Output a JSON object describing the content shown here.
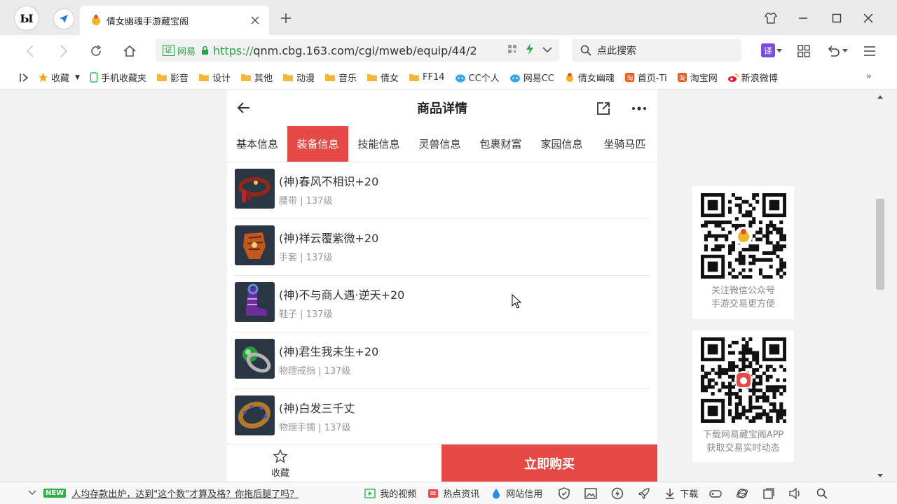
{
  "browser": {
    "logo_text": "Ы",
    "tab_title": "倩女幽魂手游藏宝阁",
    "url_scheme": "https://",
    "url_rest": "qnm.cbg.163.com/cgi/mweb/equip/44/2",
    "cert_label": "证",
    "cert_org": "网易",
    "search_placeholder": "点此搜索",
    "translate_label": "译"
  },
  "bookmarks": [
    {
      "label": "收藏",
      "icon": "star-icon"
    },
    {
      "label": "手机收藏夹",
      "icon": "phone-icon"
    },
    {
      "label": "影音",
      "icon": "folder-icon"
    },
    {
      "label": "设计",
      "icon": "folder-icon"
    },
    {
      "label": "其他",
      "icon": "folder-icon"
    },
    {
      "label": "动漫",
      "icon": "folder-icon"
    },
    {
      "label": "音乐",
      "icon": "folder-icon"
    },
    {
      "label": "倩女",
      "icon": "folder-icon"
    },
    {
      "label": "FF14",
      "icon": "folder-icon"
    },
    {
      "label": "CC个人",
      "icon": "cc-icon"
    },
    {
      "label": "网易CC",
      "icon": "cc-icon"
    },
    {
      "label": "倩女幽魂",
      "icon": "game-icon"
    },
    {
      "label": "首页-Ti",
      "icon": "taobao-icon"
    },
    {
      "label": "淘宝网",
      "icon": "taobao-icon"
    },
    {
      "label": "新浪微博",
      "icon": "weibo-icon"
    }
  ],
  "mobile": {
    "title": "商品详情",
    "tabs": [
      "基本信息",
      "装备信息",
      "技能信息",
      "灵兽信息",
      "包裹财富",
      "家园信息",
      "坐骑马匹"
    ],
    "active_tab": "装备信息",
    "items": [
      {
        "name": "(神)春风不相识+20",
        "meta": "腰带 | 137级",
        "color": "#8b2a1a"
      },
      {
        "name": "(神)祥云覆紫微+20",
        "meta": "手套 | 137级",
        "color": "#c0581f"
      },
      {
        "name": "(神)不与商人遇·逆天+20",
        "meta": "鞋子 | 137级",
        "color": "#6a2f9a"
      },
      {
        "name": "(神)君生我未生+20",
        "meta": "物理戒指 | 137级",
        "color": "#2e9a3e"
      },
      {
        "name": "(神)白发三千丈",
        "meta": "物理手镯 | 137级",
        "color": "#b07a2a"
      }
    ],
    "footer": {
      "favorite": "收藏",
      "buy": "立即购买"
    }
  },
  "qr_cards": [
    {
      "caption1": "关注微信公众号",
      "caption2": "手游交易更方便"
    },
    {
      "caption1": "下载网易藏宝阁APP",
      "caption2": "获取交易实时动态"
    }
  ],
  "statusbar": {
    "new_badge": "NEW",
    "news": "人均存款出炉，达到\"这个数\"才算及格？你拖后腿了吗？",
    "video": "我的视频",
    "hot": "热点资讯",
    "credit": "网站信用",
    "download": "下载"
  }
}
